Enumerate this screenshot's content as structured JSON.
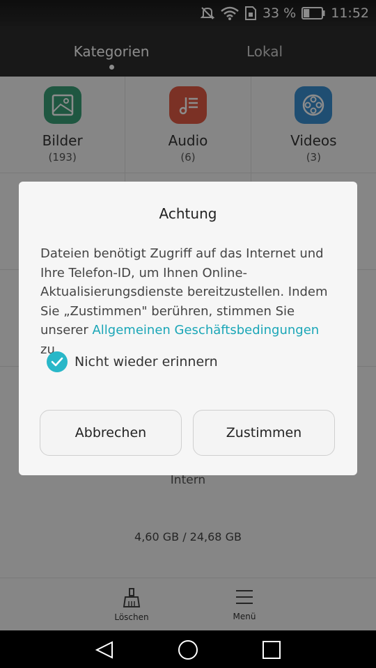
{
  "status_bar": {
    "battery_text": "33 %",
    "time": "11:52"
  },
  "tabs": [
    {
      "label": "Kategorien",
      "active": true
    },
    {
      "label": "Lokal",
      "active": false
    }
  ],
  "categories": [
    {
      "name": "Bilder",
      "count": "(193)",
      "color": "#3a9e77",
      "icon": "image-icon"
    },
    {
      "name": "Audio",
      "count": "(6)",
      "color": "#e05a44",
      "icon": "music-list-icon"
    },
    {
      "name": "Videos",
      "count": "(3)",
      "color": "#3a8ed0",
      "icon": "film-reel-icon"
    }
  ],
  "storage": {
    "label": "Intern",
    "size": "4,60 GB / 24,68 GB",
    "used_fraction": 0.186
  },
  "bottom_bar": {
    "delete_label": "Löschen",
    "menu_label": "Menü"
  },
  "dialog": {
    "title": "Achtung",
    "message_text": "Dateien benötigt Zugriff auf das Internet und Ihre Telefon-ID, um Ihnen Online-Aktualisierungsdienste bereitzustellen. Indem Sie „Zustimmen\" berühren, stimmen Sie unserer ",
    "message_link": "Allgemeinen Geschäftsbedingungen",
    "message_suffix": " zu.",
    "checkbox_label": "Nicht wieder erinnern",
    "checkbox_checked": true,
    "cancel_label": "Abbrechen",
    "accept_label": "Zustimmen",
    "accent_color": "#28b7c8"
  }
}
